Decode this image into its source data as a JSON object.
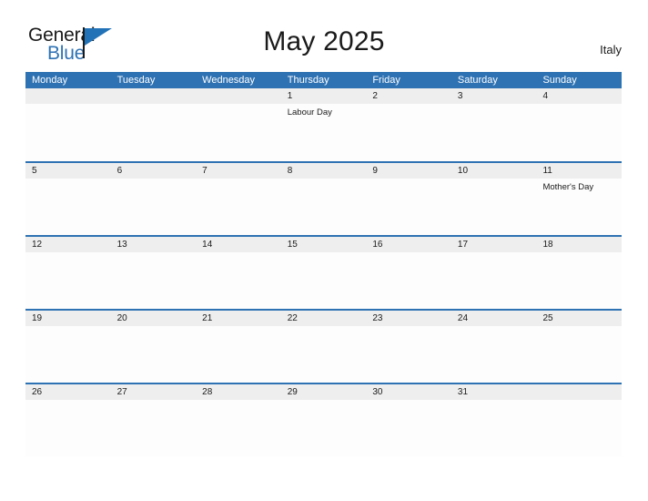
{
  "header": {
    "logo": {
      "text_top": "General",
      "text_bottom": "Blue",
      "flag_icon": "blue-flag-icon",
      "blue": "#2272B7"
    },
    "title": "May 2025",
    "country": "Italy"
  },
  "calendar": {
    "accent_color": "#2E72B3",
    "band_color": "#eeeeee",
    "weekdays": [
      "Monday",
      "Tuesday",
      "Wednesday",
      "Thursday",
      "Friday",
      "Saturday",
      "Sunday"
    ],
    "weeks": [
      [
        {
          "date": "",
          "events": []
        },
        {
          "date": "",
          "events": []
        },
        {
          "date": "",
          "events": []
        },
        {
          "date": "1",
          "events": [
            "Labour Day"
          ]
        },
        {
          "date": "2",
          "events": []
        },
        {
          "date": "3",
          "events": []
        },
        {
          "date": "4",
          "events": []
        }
      ],
      [
        {
          "date": "5",
          "events": []
        },
        {
          "date": "6",
          "events": []
        },
        {
          "date": "7",
          "events": []
        },
        {
          "date": "8",
          "events": []
        },
        {
          "date": "9",
          "events": []
        },
        {
          "date": "10",
          "events": []
        },
        {
          "date": "11",
          "events": [
            "Mother's Day"
          ]
        }
      ],
      [
        {
          "date": "12",
          "events": []
        },
        {
          "date": "13",
          "events": []
        },
        {
          "date": "14",
          "events": []
        },
        {
          "date": "15",
          "events": []
        },
        {
          "date": "16",
          "events": []
        },
        {
          "date": "17",
          "events": []
        },
        {
          "date": "18",
          "events": []
        }
      ],
      [
        {
          "date": "19",
          "events": []
        },
        {
          "date": "20",
          "events": []
        },
        {
          "date": "21",
          "events": []
        },
        {
          "date": "22",
          "events": []
        },
        {
          "date": "23",
          "events": []
        },
        {
          "date": "24",
          "events": []
        },
        {
          "date": "25",
          "events": []
        }
      ],
      [
        {
          "date": "26",
          "events": []
        },
        {
          "date": "27",
          "events": []
        },
        {
          "date": "28",
          "events": []
        },
        {
          "date": "29",
          "events": []
        },
        {
          "date": "30",
          "events": []
        },
        {
          "date": "31",
          "events": []
        },
        {
          "date": "",
          "events": []
        }
      ]
    ]
  }
}
